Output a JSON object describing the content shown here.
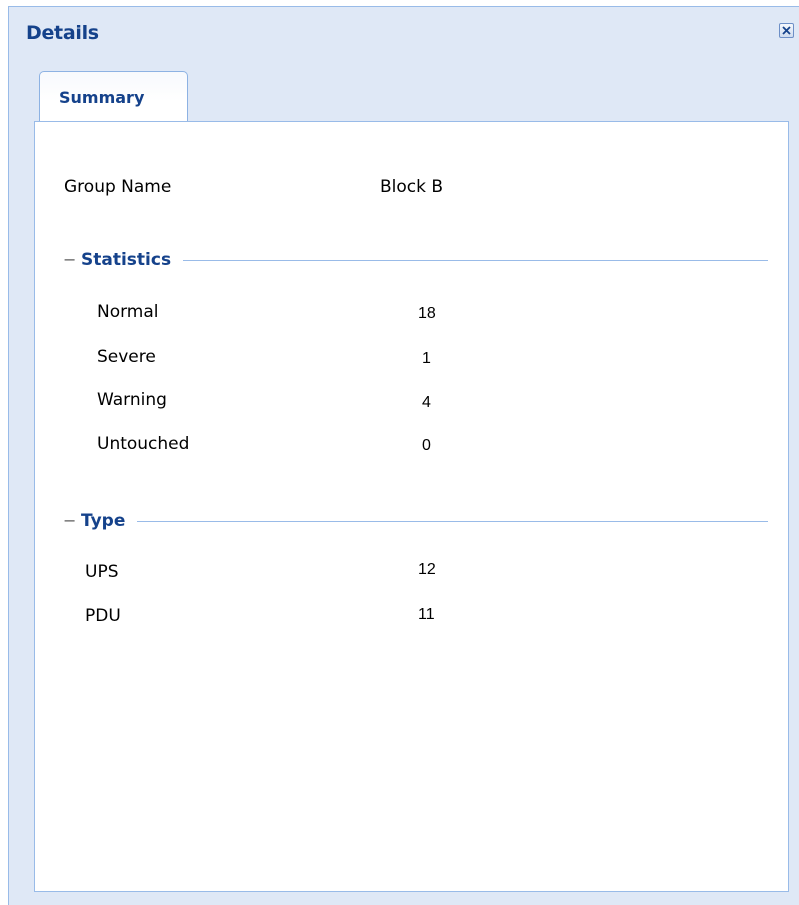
{
  "panel": {
    "title": "Details",
    "close_icon": "close-icon"
  },
  "tabs": [
    {
      "label": "Summary",
      "active": true
    }
  ],
  "summary": {
    "group_name_label": "Group Name",
    "group_name_value": "Block B",
    "statistics": {
      "legend": "Statistics",
      "toggle": "−",
      "items": [
        {
          "label": "Normal",
          "value": "18"
        },
        {
          "label": "Severe",
          "value": "1"
        },
        {
          "label": "Warning",
          "value": "4"
        },
        {
          "label": "Untouched",
          "value": "0"
        }
      ]
    },
    "type": {
      "legend": "Type",
      "toggle": "−",
      "items": [
        {
          "label": "UPS",
          "value": "12"
        },
        {
          "label": "PDU",
          "value": "11"
        }
      ]
    }
  },
  "colors": {
    "header_bg": "#dfe8f6",
    "title_text": "#15428b",
    "border": "#99bbe8"
  }
}
